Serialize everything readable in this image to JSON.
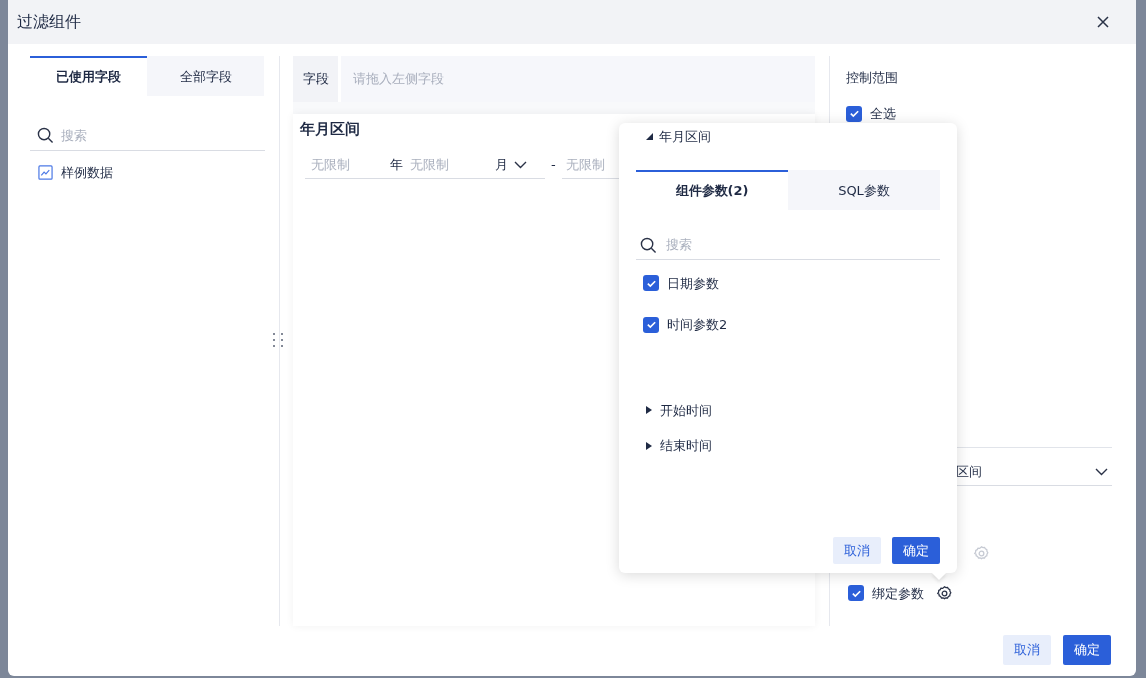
{
  "dialog": {
    "title": "过滤组件"
  },
  "field_tabs": [
    {
      "label": "已使用字段",
      "selected": true
    },
    {
      "label": "全部字段",
      "selected": false
    }
  ],
  "field_search": {
    "placeholder": "搜索"
  },
  "fields": [
    {
      "label": "样例数据"
    }
  ],
  "field_drop": {
    "label": "字段",
    "placeholder": "请拖入左侧字段"
  },
  "widget": {
    "title": "年月区间",
    "start_year": {
      "placeholder": "无限制",
      "unit": "年"
    },
    "start_month": {
      "placeholder": "无限制",
      "unit": "月"
    },
    "separator": "-",
    "end_year": {
      "placeholder": "无限制"
    }
  },
  "control": {
    "title": "控制范围",
    "select_all": {
      "label": "全选",
      "checked": true
    },
    "dropdown_value": "区间",
    "bind_param": {
      "label": "绑定参数",
      "checked": true
    }
  },
  "popover": {
    "title": "年月区间",
    "expanded": true,
    "tabs": [
      {
        "label": "组件参数(2)",
        "selected": true
      },
      {
        "label": "SQL参数",
        "selected": false
      }
    ],
    "search": {
      "placeholder": "搜索"
    },
    "params": [
      {
        "label": "日期参数",
        "checked": true
      },
      {
        "label": "时间参数2",
        "checked": true
      }
    ],
    "tree": [
      {
        "label": "开始时间",
        "expanded": false
      },
      {
        "label": "结束时间",
        "expanded": false
      }
    ],
    "buttons": [
      {
        "label": "取消",
        "kind": "secondary"
      },
      {
        "label": "确定",
        "kind": "primary"
      }
    ]
  },
  "footer_buttons": [
    {
      "label": "取消",
      "kind": "secondary"
    },
    {
      "label": "确定",
      "kind": "primary"
    }
  ]
}
